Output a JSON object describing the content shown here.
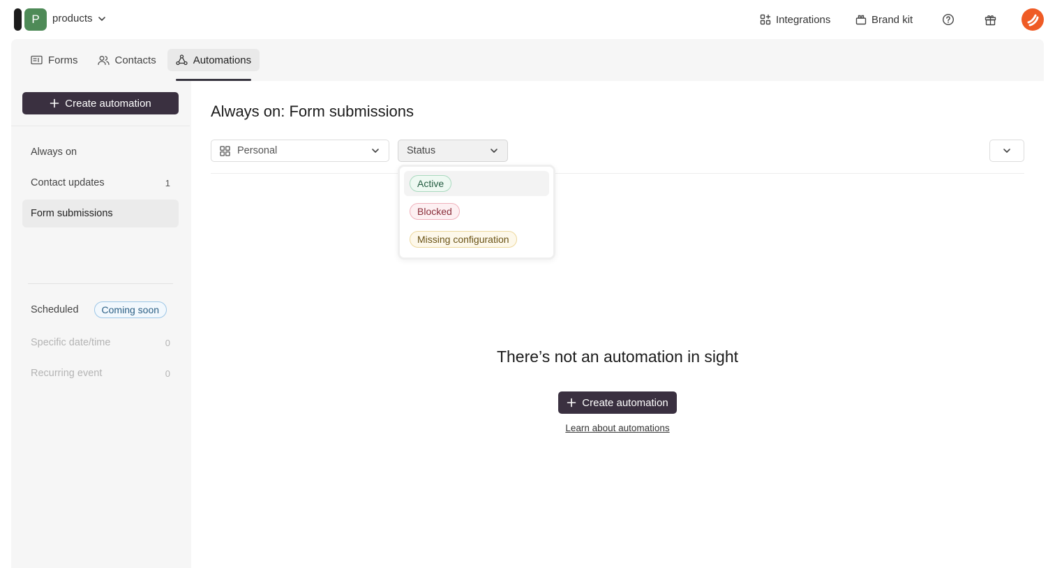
{
  "workspace": {
    "initial": "P",
    "name": "products",
    "badge_color": "#4e8a57"
  },
  "header": {
    "integrations_label": "Integrations",
    "brand_kit_label": "Brand kit",
    "icons": [
      "help-icon",
      "gift-icon",
      "user-avatar"
    ]
  },
  "tabs": [
    {
      "label": "Forms",
      "icon": "form-icon"
    },
    {
      "label": "Contacts",
      "icon": "contacts-icon"
    },
    {
      "label": "Automations",
      "icon": "automations-icon",
      "active": true
    }
  ],
  "sidebar": {
    "create_label": "Create automation",
    "items": [
      {
        "label": "Always on",
        "count": ""
      },
      {
        "label": "Contact updates",
        "count": "1"
      },
      {
        "label": "Form submissions",
        "count": "",
        "active": true
      }
    ],
    "scheduled": {
      "label": "Scheduled",
      "badge": "Coming soon"
    },
    "scheduled_items": [
      {
        "label": "Specific date/time",
        "count": "0"
      },
      {
        "label": "Recurring event",
        "count": "0"
      }
    ]
  },
  "main": {
    "title": "Always on: Form submissions",
    "filters": {
      "view": "Personal",
      "status": "Status"
    },
    "status_options": [
      {
        "label": "Active",
        "color": "#235c40"
      },
      {
        "label": "Blocked",
        "color": "#8a2e3a"
      },
      {
        "label": "Missing configuration",
        "color": "#6a5316"
      }
    ],
    "empty": {
      "title": "There’s not an automation in sight",
      "button_label": "Create automation",
      "link_label": "Learn about automations"
    }
  },
  "colors": {
    "primary_button": "#3a3040",
    "avatar": "#ef5b25"
  }
}
